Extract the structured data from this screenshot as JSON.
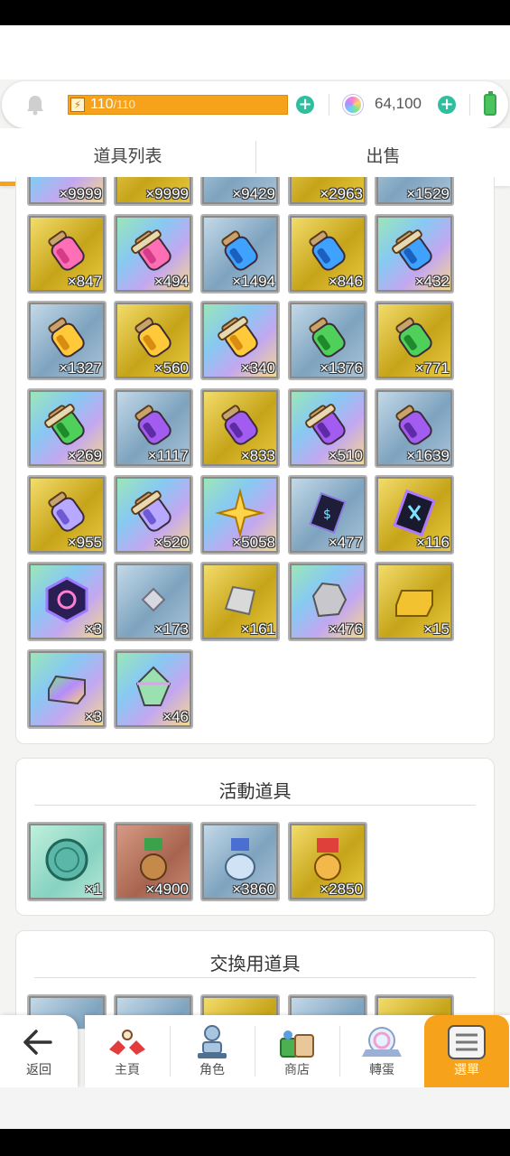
{
  "resources": {
    "energy_current": "110",
    "energy_max": "/110",
    "energy_fraction": 1.0,
    "gems": "64,100"
  },
  "tabs": [
    {
      "label": "道具列表",
      "active": true
    },
    {
      "label": "出售",
      "active": false
    }
  ],
  "inventory": {
    "partial_row_counts": [
      "×9999",
      "×9999",
      "×9429",
      "×2963",
      "×1529"
    ],
    "items": [
      {
        "count": "×847",
        "icon": "pink-potion-icon",
        "bg": "gold"
      },
      {
        "count": "×494",
        "icon": "pink-scroll-potion-icon",
        "bg": "rainbow"
      },
      {
        "count": "×1494",
        "icon": "blue-potion-icon",
        "bg": "blue"
      },
      {
        "count": "×846",
        "icon": "blue-potion-icon",
        "bg": "gold"
      },
      {
        "count": "×432",
        "icon": "blue-scroll-potion-icon",
        "bg": "rainbow"
      },
      {
        "count": "×1327",
        "icon": "yellow-potion-icon",
        "bg": "blue"
      },
      {
        "count": "×560",
        "icon": "yellow-potion-icon",
        "bg": "gold"
      },
      {
        "count": "×340",
        "icon": "yellow-scroll-potion-icon",
        "bg": "rainbow"
      },
      {
        "count": "×1376",
        "icon": "green-potion-icon",
        "bg": "blue"
      },
      {
        "count": "×771",
        "icon": "green-potion-icon",
        "bg": "gold"
      },
      {
        "count": "×269",
        "icon": "green-scroll-potion-icon",
        "bg": "rainbow"
      },
      {
        "count": "×1117",
        "icon": "purple-potion-icon",
        "bg": "blue"
      },
      {
        "count": "×833",
        "icon": "purple-potion-icon",
        "bg": "gold"
      },
      {
        "count": "×510",
        "icon": "purple-scroll-potion-icon",
        "bg": "rainbow"
      },
      {
        "count": "×1639",
        "icon": "purple-potion-icon",
        "bg": "blue"
      },
      {
        "count": "×955",
        "icon": "lavender-potion-icon",
        "bg": "gold"
      },
      {
        "count": "×520",
        "icon": "lavender-scroll-potion-icon",
        "bg": "rainbow"
      },
      {
        "count": "×5058",
        "icon": "sparkle-star-icon",
        "bg": "rainbow"
      },
      {
        "count": "×477",
        "icon": "dark-rune-card-icon",
        "bg": "blue"
      },
      {
        "count": "×116",
        "icon": "rainbow-rune-card-icon",
        "bg": "gold"
      },
      {
        "count": "×3",
        "icon": "rainbow-emblem-icon",
        "bg": "rainbow"
      },
      {
        "count": "×173",
        "icon": "small-crystal-icon",
        "bg": "blue"
      },
      {
        "count": "×161",
        "icon": "stone-shard-icon",
        "bg": "gold"
      },
      {
        "count": "×476",
        "icon": "rock-ore-icon",
        "bg": "rainbow"
      },
      {
        "count": "×15",
        "icon": "gold-ingot-icon",
        "bg": "gold"
      },
      {
        "count": "×3",
        "icon": "rainbow-ingot-icon",
        "bg": "rainbow"
      },
      {
        "count": "×46",
        "icon": "rainbow-gem-icon",
        "bg": "rainbow"
      }
    ]
  },
  "event_items": {
    "title": "活動道具",
    "items": [
      {
        "count": "×1",
        "icon": "teal-coin-icon",
        "bg": "teal"
      },
      {
        "count": "×4900",
        "icon": "cookie-figure-icon",
        "bg": "brown"
      },
      {
        "count": "×3860",
        "icon": "snow-ghost-icon",
        "bg": "blue"
      },
      {
        "count": "×2850",
        "icon": "gift-cookie-icon",
        "bg": "gold"
      }
    ]
  },
  "exchange_items": {
    "title": "交換用道具"
  },
  "nav": [
    {
      "label": "返回",
      "icon": "back-arrow-icon"
    },
    {
      "label": "主頁",
      "icon": "home-icon"
    },
    {
      "label": "角色",
      "icon": "character-icon"
    },
    {
      "label": "商店",
      "icon": "shop-icon"
    },
    {
      "label": "轉蛋",
      "icon": "gacha-icon"
    },
    {
      "label": "選單",
      "icon": "menu-icon",
      "active": true
    }
  ],
  "colors": {
    "accent": "#f7a21b",
    "plus": "#2dbf9e",
    "battery": "#4cc35f"
  }
}
